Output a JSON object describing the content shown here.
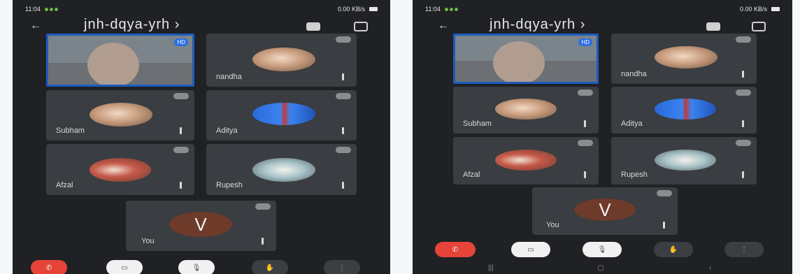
{
  "screens": [
    {
      "status": {
        "time": "11:04",
        "right": "0.00 KB/s"
      },
      "title": "jnh-dqya-yrh",
      "self_badge": "HD",
      "participants": [
        "nandha",
        "Subham",
        "Aditya",
        "Afzal",
        "Rupesh",
        "You"
      ],
      "you_initial": "V"
    },
    {
      "status": {
        "time": "11:04",
        "right": "0.00 KB/s"
      },
      "title": "jnh-dqya-yrh",
      "self_badge": "HD",
      "participants": [
        "nandha",
        "Subham",
        "Aditya",
        "Afzal",
        "Rupesh",
        "You"
      ],
      "you_initial": "V"
    }
  ],
  "icons": {
    "back": "arrow-left-icon",
    "speaker": "speaker-icon",
    "camera_switch": "switch-camera-icon",
    "end_call": "end-call-icon",
    "video": "video-icon",
    "mic": "mic-icon",
    "hand": "raise-hand-icon",
    "more": "more-icon"
  }
}
